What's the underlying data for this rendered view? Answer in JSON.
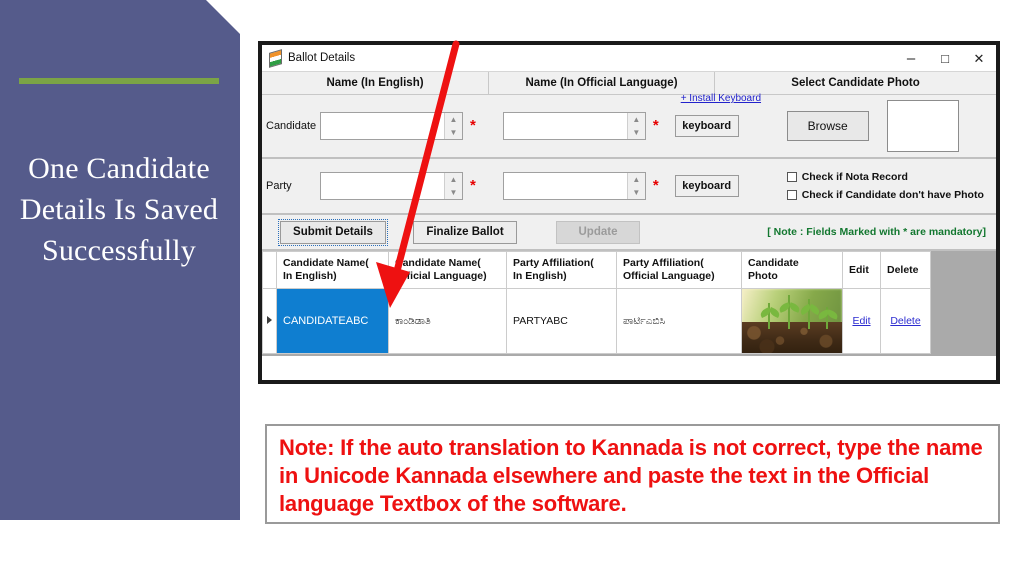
{
  "sidebar": {
    "title": "One Candidate Details Is Saved Successfully",
    "background_color": "#555b8b",
    "accent_rule_color": "#7ba446"
  },
  "window": {
    "title": "Ballot Details",
    "icon": "ballot-icon",
    "controls": {
      "minimize": "–",
      "maximize": "□",
      "close": "✕"
    }
  },
  "column_headers": {
    "name_english": "Name (In English)",
    "name_official": "Name (In Official Language)",
    "select_photo": "Select Candidate Photo"
  },
  "form": {
    "candidate_label": "Candidate",
    "party_label": "Party",
    "candidate_name_english": "",
    "candidate_name_official": "",
    "party_name_english": "",
    "party_name_official": "",
    "required_marker": "*",
    "install_keyboard_link": "+ Install Keyboard",
    "keyboard_button": "keyboard",
    "browse_button": "Browse",
    "checkbox_nota": "Check if Nota Record",
    "checkbox_no_photo": "Check if Candidate don't have Photo",
    "checkbox_nota_checked": false,
    "checkbox_no_photo_checked": false
  },
  "buttons": {
    "submit": "Submit Details",
    "finalize": "Finalize Ballot",
    "update": "Update",
    "update_disabled": true,
    "mandatory_note": "[ Note : Fields Marked with * are mandatory]",
    "mandatory_note_color": "#12772f"
  },
  "grid": {
    "headers": [
      "",
      "Candidate Name( In English)",
      "Candidate Name( Official Language)",
      "Party Affiliation( In English)",
      "Party Affiliation( Official Language)",
      "Candidate Photo",
      "Edit",
      "Delete"
    ],
    "headers_split": [
      {
        "line1": "",
        "line2": ""
      },
      {
        "line1": "Candidate Name(",
        "line2": "In English)"
      },
      {
        "line1": "Candidate Name(",
        "line2": "Official Language)"
      },
      {
        "line1": "Party Affiliation(",
        "line2": "In English)"
      },
      {
        "line1": "Party Affiliation(",
        "line2": "Official Language)"
      },
      {
        "line1": "Candidate",
        "line2": "Photo"
      },
      {
        "line1": "Edit",
        "line2": ""
      },
      {
        "line1": "Delete",
        "line2": ""
      }
    ],
    "rows": [
      {
        "row_marker": "▶",
        "candidate_name_english": "CANDIDATEABC",
        "candidate_name_official": "ಕಾಂಡಿಡಾತಿ",
        "party_affiliation_english": "PARTYABC",
        "party_affiliation_official": "ಪಾರ್ಟಿಎಬಿಸಿ",
        "photo": "candidate-photo-seedlings",
        "edit_link": "Edit",
        "delete_link": "Delete",
        "selected_cell": "candidate_name_english",
        "selection_color": "#0f7ed0"
      }
    ]
  },
  "annotation": {
    "arrow_color": "#ee1111"
  },
  "note": {
    "text": "Note: If the auto translation to Kannada is not correct, type the name in Unicode Kannada elsewhere and paste the text in the Official language Textbox of the software.",
    "color": "#ee1111"
  }
}
